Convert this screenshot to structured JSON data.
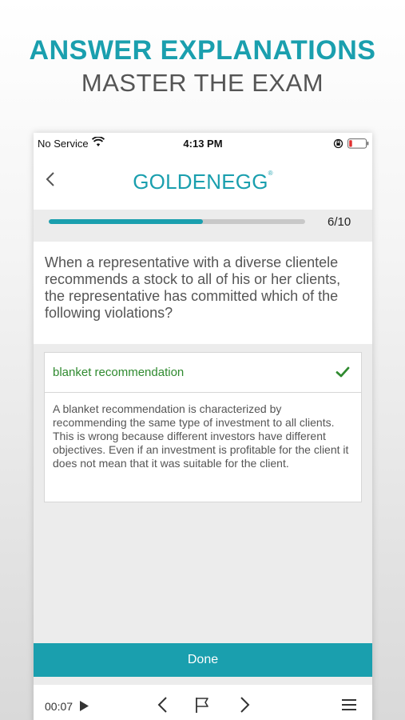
{
  "promo": {
    "title": "ANSWER EXPLANATIONS",
    "subtitle": "MASTER THE EXAM"
  },
  "status_bar": {
    "carrier": "No Service",
    "time": "4:13 PM",
    "icons": [
      "wifi-icon",
      "orientation-lock-icon",
      "battery-low-icon"
    ]
  },
  "header": {
    "logo": "GOLDENEGG",
    "logo_mark": "®",
    "back_icon": "chevron-left-icon"
  },
  "progress": {
    "label": "6/10",
    "fraction": 0.6
  },
  "question": {
    "text": "When a representative with a diverse clientele recommends a stock to all of his or her clients, the representative has committed which of the following violations?"
  },
  "answer": {
    "label": "blanket recommendation",
    "icon": "check-icon",
    "explanation": "A blanket recommendation is characterized by recommending the same type of investment to all clients. This is wrong because different investors have different objectives. Even if an investment is profitable for the client it does not mean that it was suitable for the client."
  },
  "done_button": "Done",
  "bottom_bar": {
    "timer": "00:07",
    "icons": [
      "play-icon",
      "chevron-left-icon",
      "flag-icon",
      "chevron-right-icon",
      "menu-icon"
    ]
  },
  "colors": {
    "accent": "#1a9fae",
    "correct": "#2f8a2f",
    "battery": "#e03030"
  }
}
